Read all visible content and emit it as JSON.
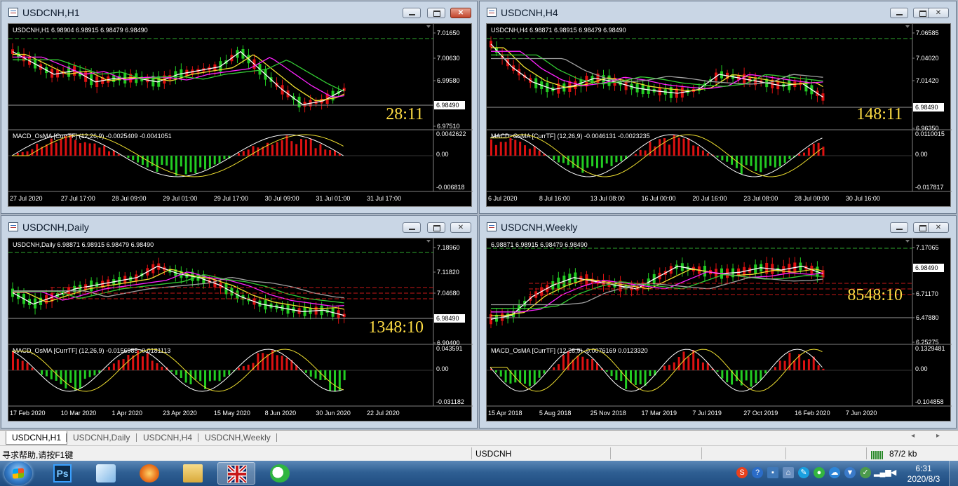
{
  "windows": [
    {
      "title": "USDCNH,H1",
      "close_active": true,
      "header": "USDCNH,H1  6.98904 6.98915 6.98479 6.98490",
      "macd_label": "MACD_OsMA [CurrTF] (12,26,9) -0.0025409 -0.0041051",
      "price_ticks": [
        "7.01650",
        "7.00630",
        "6.99580",
        "6.98490",
        "6.97510"
      ],
      "macd_ticks": [
        "0.0042622",
        "0.00",
        "-0.006818"
      ],
      "time_labels": [
        "27 Jul 2020",
        "27 Jul 17:00",
        "28 Jul 09:00",
        "29 Jul 01:00",
        "29 Jul 17:00",
        "30 Jul 09:00",
        "31 Jul 01:00",
        "31 Jul 17:00"
      ],
      "countdown": "28:11",
      "marker_line": "dash",
      "has_grey_ma": false,
      "bars": 60
    },
    {
      "title": "USDCNH,H4",
      "close_active": false,
      "header": "USDCNH,H4  6.98871 6.98915 6.98479 6.98490",
      "macd_label": "MACD_OsMA [CurrTF] (12,26,9) -0.0046131 -0.0023235",
      "price_ticks": [
        "7.06585",
        "7.04020",
        "7.01420",
        "6.98490",
        "6.96350"
      ],
      "macd_ticks": [
        "0.0110015",
        "0.00",
        "-0.017817"
      ],
      "time_labels": [
        "6 Jul 2020",
        "8 Jul 16:00",
        "13 Jul 08:00",
        "16 Jul 00:00",
        "20 Jul 16:00",
        "23 Jul 08:00",
        "28 Jul 00:00",
        "30 Jul 16:00"
      ],
      "countdown": "148:11",
      "marker_line": "dash",
      "has_grey_ma": true,
      "bars": 60
    },
    {
      "title": "USDCNH,Daily",
      "close_active": false,
      "header": "USDCNH,Daily  6.98871 6.98915 6.98479 6.98490",
      "macd_label": "MACD_OsMA [CurrTF] (12,26,9) -0.0156985 -0.0181113",
      "price_ticks": [
        "7.18960",
        "7.11820",
        "7.04680",
        "6.98490",
        "6.90400"
      ],
      "macd_ticks": [
        "0.043591",
        "0.00",
        "-0.031182"
      ],
      "time_labels": [
        "17 Feb 2020",
        "10 Mar 2020",
        "1 Apr 2020",
        "23 Apr 2020",
        "15 May 2020",
        "8 Jun 2020",
        "30 Jun 2020",
        "22 Jul 2020"
      ],
      "countdown": "1348:10",
      "marker_line": "red",
      "has_grey_ma": true,
      "bars": 60
    },
    {
      "title": "USDCNH,Weekly",
      "close_active": false,
      "header": "6.98871 6.98915 6.98479 6.98490",
      "macd_label": "MACD_OsMA [CurrTF] (12,26,9) -0.0076169 0.0123320",
      "price_ticks": [
        "7.17065",
        "6.98490",
        "6.71170",
        "6.47880",
        "6.25275"
      ],
      "macd_ticks": [
        "0.1329481",
        "0.00",
        "-0.104858"
      ],
      "time_labels": [
        "15 Apr 2018",
        "5 Aug 2018",
        "25 Nov 2018",
        "17 Mar 2019",
        "7 Jul 2019",
        "27 Oct 2019",
        "16 Feb 2020",
        "7 Jun 2020"
      ],
      "countdown": "8548:10",
      "marker_line": "red",
      "has_grey_ma": true,
      "bars": 60
    }
  ],
  "tabs": [
    "USDCNH,H1",
    "USDCNH,Daily",
    "USDCNH,H4",
    "USDCNH,Weekly"
  ],
  "active_tab": 0,
  "tab_arrows": "◂ ▸",
  "status": {
    "help": "寻求帮助,请按F1键",
    "symbol": "USDCNH",
    "traffic": "87/2 kb"
  },
  "taskbar": {
    "apps": [
      {
        "name": "photoshop",
        "label": "Ps"
      },
      {
        "name": "paint-app"
      },
      {
        "name": "browser-app"
      },
      {
        "name": "file-explorer"
      },
      {
        "name": "trading-terminal",
        "active": true
      },
      {
        "name": "wechat"
      }
    ],
    "clock_time": "6:31",
    "clock_date": "2020/8/3"
  },
  "colors": {
    "chart_bg": "#000000",
    "bull": "#22cc22",
    "bear": "#dd1111",
    "ma_white": "#ffffff",
    "ma_yellow": "#f0e030",
    "ma_magenta": "#ff22ff",
    "ma_green": "#33cc33",
    "ma_grey": "#a0a0a0",
    "countdown": "#ffdd44",
    "axis_text": "#ffffff"
  }
}
